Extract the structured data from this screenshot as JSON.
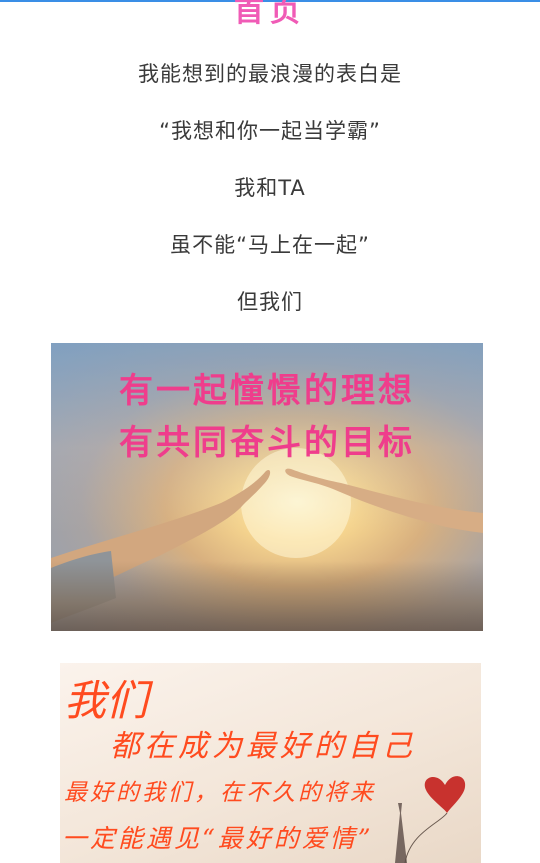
{
  "header": {
    "title_fragment": "首页"
  },
  "article": {
    "lines": [
      "我能想到的最浪漫的表白是",
      "“我想和你一起当学霸”",
      "我和TA",
      "虽不能“马上在一起”",
      "但我们"
    ]
  },
  "image1": {
    "caption_line1": "有一起憧憬的理想",
    "caption_line2": "有共同奋斗的目标"
  },
  "image2": {
    "line1": "我们",
    "line2": "都在成为最好的自己",
    "line3": "最好的我们，在不久的将来",
    "line4": "一定能遇见“最好的爱情”"
  },
  "colors": {
    "accent_pink": "#ef3d8c",
    "handwriting_red": "#ff4b1f",
    "top_bar": "#3a8ee6"
  }
}
